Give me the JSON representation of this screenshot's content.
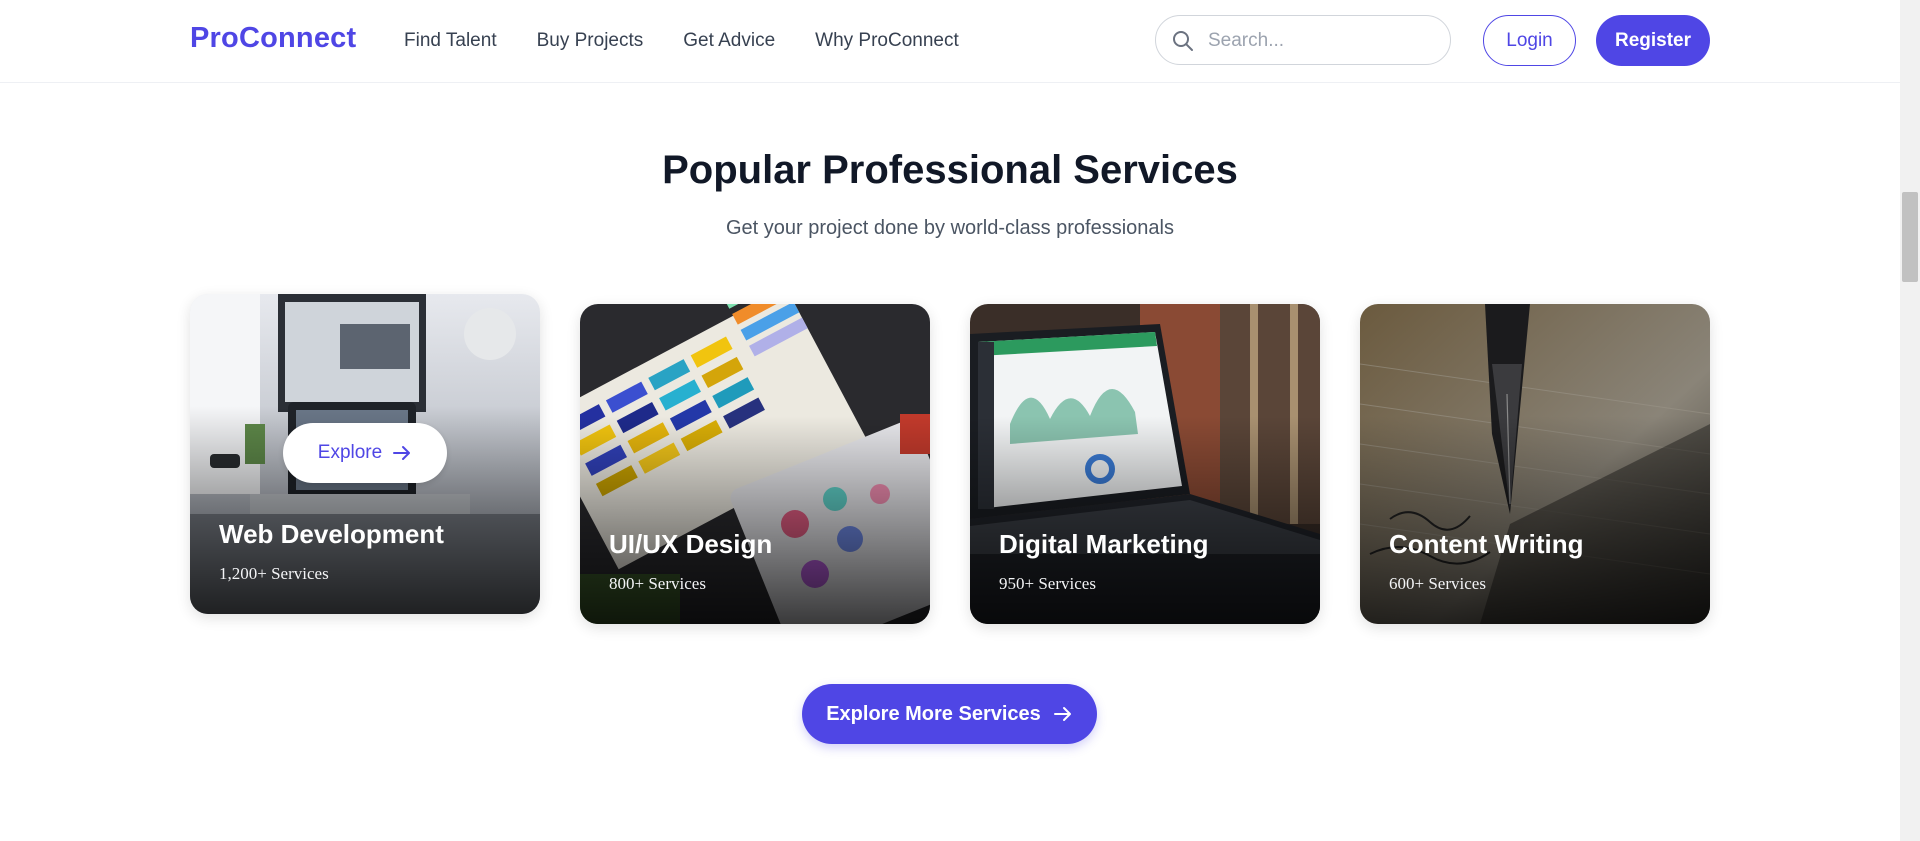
{
  "brand": {
    "name": "ProConnect",
    "accent": "#4f46e5"
  },
  "nav": {
    "links": [
      "Find Talent",
      "Buy Projects",
      "Get Advice",
      "Why ProConnect"
    ],
    "search": {
      "placeholder": "Search...",
      "icon": "search-icon"
    },
    "login_label": "Login",
    "register_label": "Register"
  },
  "services": {
    "title": "Popular Professional Services",
    "subtitle": "Get your project done by world-class professionals",
    "hover_label": "Explore",
    "cards": [
      {
        "title": "Web Development",
        "count": "1,200+ Services",
        "image": "laptop-desk-photo"
      },
      {
        "title": "UI/UX Design",
        "count": "800+ Services",
        "image": "color-swatches-photo"
      },
      {
        "title": "Digital Marketing",
        "count": "950+ Services",
        "image": "analytics-laptop-photo"
      },
      {
        "title": "Content Writing",
        "count": "600+ Services",
        "image": "fountain-pen-photo"
      }
    ],
    "cta_label": "Explore More Services"
  }
}
